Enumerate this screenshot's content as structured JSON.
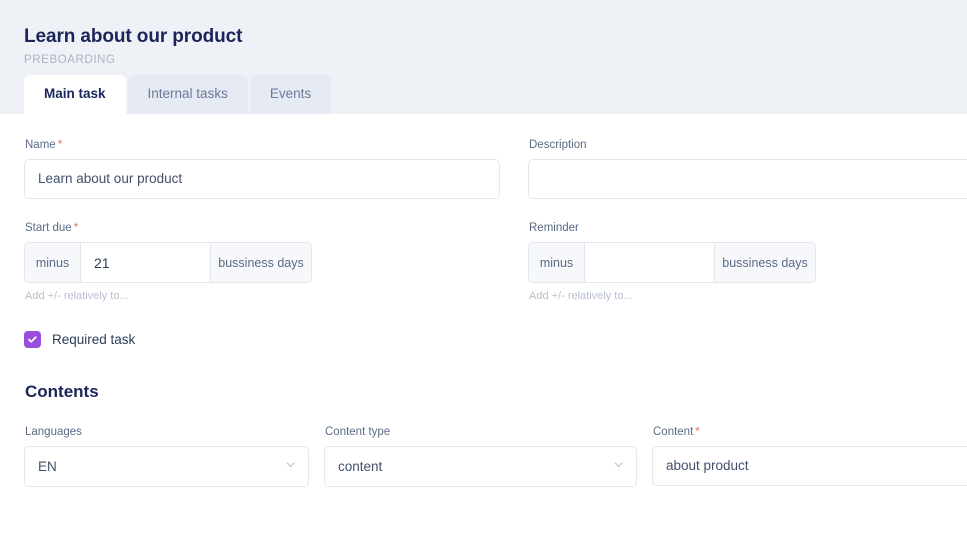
{
  "header": {
    "title": "Learn about our product",
    "subtitle": "PREBOARDING"
  },
  "tabs": [
    {
      "label": "Main task",
      "active": true
    },
    {
      "label": "Internal tasks",
      "active": false
    },
    {
      "label": "Events",
      "active": false
    }
  ],
  "form": {
    "name": {
      "label": "Name",
      "required_marker": "*",
      "value": "Learn about our product"
    },
    "description": {
      "label": "Description",
      "value": ""
    },
    "start_due": {
      "label": "Start due",
      "required_marker": "*",
      "operator": "minus",
      "value": "21",
      "unit": "bussiness days",
      "hint": "Add +/- relatively to..."
    },
    "reminder": {
      "label": "Reminder",
      "operator": "minus",
      "value": "",
      "unit": "bussiness days",
      "hint": "Add +/- relatively to..."
    },
    "required_task": {
      "label": "Required task",
      "checked": true
    }
  },
  "contents": {
    "section_title": "Contents",
    "languages": {
      "label": "Languages",
      "value": "EN"
    },
    "content_type": {
      "label": "Content type",
      "value": "content"
    },
    "content": {
      "label": "Content",
      "required_marker": "*",
      "value": "about product"
    }
  },
  "colors": {
    "accent_purple": "#9b4ddb",
    "required_red": "#f4685d",
    "header_bg": "#eef1f6",
    "title_navy": "#1b2559"
  }
}
